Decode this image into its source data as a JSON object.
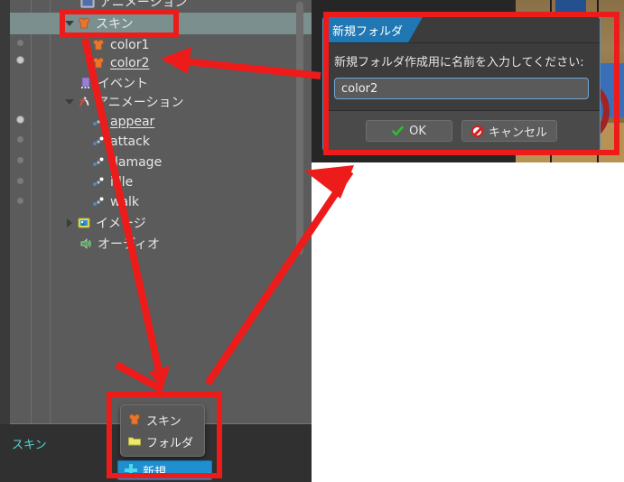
{
  "app": {
    "selection_status": "スキン"
  },
  "tree": {
    "rows": [
      {
        "label": "アニメーション",
        "icon": "animation-folder-icon",
        "depth": 1,
        "twisty": "none",
        "partial": true,
        "underline": false,
        "gutter_dot": "none"
      },
      {
        "label": "スキン",
        "icon": "skin-icon",
        "depth": 1,
        "twisty": "open",
        "selected": true,
        "underline": false,
        "gutter_dot": "none"
      },
      {
        "label": "color1",
        "icon": "skin-icon",
        "depth": 2,
        "twisty": "none",
        "underline": false,
        "gutter_dot": "dim"
      },
      {
        "label": "color2",
        "icon": "skin-icon",
        "depth": 2,
        "twisty": "none",
        "underline": true,
        "gutter_dot": "on"
      },
      {
        "label": "イベント",
        "icon": "event-icon",
        "depth": 1,
        "twisty": "none",
        "underline": false,
        "gutter_dot": "none"
      },
      {
        "label": "アニメーション",
        "icon": "animation-icon",
        "depth": 1,
        "twisty": "open",
        "underline": false,
        "gutter_dot": "none"
      },
      {
        "label": "appear",
        "icon": "keyframe-icon",
        "depth": 2,
        "twisty": "none",
        "underline": true,
        "gutter_dot": "on"
      },
      {
        "label": "attack",
        "icon": "keyframe-icon",
        "depth": 2,
        "twisty": "none",
        "underline": false,
        "gutter_dot": "dim"
      },
      {
        "label": "damage",
        "icon": "keyframe-icon",
        "depth": 2,
        "twisty": "none",
        "underline": false,
        "gutter_dot": "dim"
      },
      {
        "label": "idle",
        "icon": "keyframe-icon",
        "depth": 2,
        "twisty": "none",
        "underline": false,
        "gutter_dot": "dim"
      },
      {
        "label": "walk",
        "icon": "keyframe-icon",
        "depth": 2,
        "twisty": "none",
        "underline": false,
        "gutter_dot": "dim"
      },
      {
        "label": "イメージ",
        "icon": "image-icon",
        "depth": 1,
        "twisty": "closed",
        "underline": false,
        "gutter_dot": "none"
      },
      {
        "label": "オーディオ",
        "icon": "audio-icon",
        "depth": 1,
        "twisty": "none",
        "underline": false,
        "gutter_dot": "none"
      }
    ]
  },
  "new_button": {
    "label": "新規...",
    "icon": "plus-icon"
  },
  "popup_menu": {
    "items": [
      {
        "label": "スキン",
        "icon": "skin-icon"
      },
      {
        "label": "フォルダ",
        "icon": "folder-icon"
      }
    ]
  },
  "dialog": {
    "title": "新規フォルダ",
    "prompt": "新規フォルダ作成用に名前を入力してください:",
    "input_value": "color2",
    "input_placeholder": "",
    "ok_label": "OK",
    "ok_icon": "check-icon",
    "cancel_label": "キャンセル",
    "cancel_icon": "ban-icon"
  },
  "colors": {
    "accent_blue": "#1f78b4",
    "button_blue": "#1f8fd0",
    "annotation_red": "#ee1b1b",
    "panel_bg": "#5b5b5b",
    "selection": "#7b8f8f",
    "status_text": "#4fd8d8"
  }
}
